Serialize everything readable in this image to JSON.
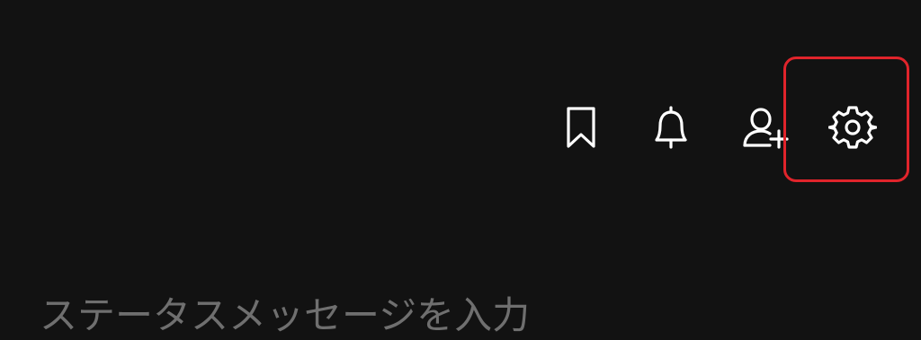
{
  "colors": {
    "background": "#121212",
    "icon": "#ffffff",
    "highlight": "#e0242b",
    "placeholder": "#6f6f6f"
  },
  "toolbar": {
    "icons": [
      "bookmark-icon",
      "bell-icon",
      "add-friend-icon",
      "gear-icon"
    ]
  },
  "status": {
    "placeholder": "ステータスメッセージを入力"
  }
}
